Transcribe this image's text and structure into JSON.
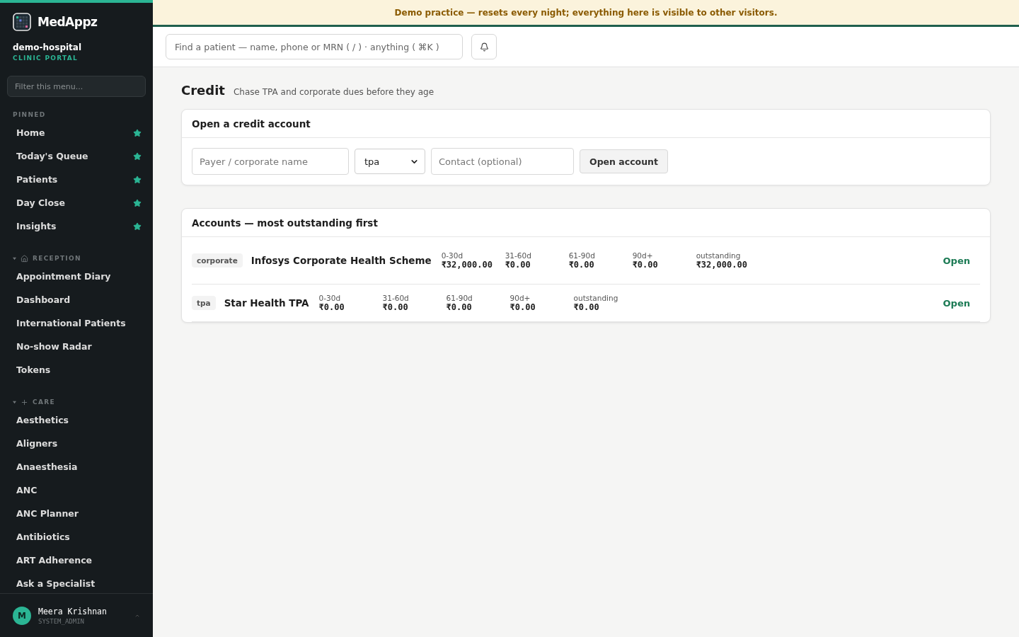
{
  "banner": "Demo practice — resets every night; everything here is visible to other visitors.",
  "brand": {
    "name": "MedAppz",
    "org": "demo-hospital",
    "portal": "CLINIC PORTAL"
  },
  "sidebar": {
    "filter_placeholder": "Filter this menu...",
    "pinned_title": "PINNED",
    "pinned": [
      {
        "label": "Home",
        "starred": true
      },
      {
        "label": "Today's Queue",
        "starred": true
      },
      {
        "label": "Patients",
        "starred": true
      },
      {
        "label": "Day Close",
        "starred": true
      },
      {
        "label": "Insights",
        "starred": true
      }
    ],
    "sections": [
      {
        "title": "RECEPTION",
        "kind": "home",
        "expanded": true,
        "items": [
          "Appointment Diary",
          "Dashboard",
          "International Patients",
          "No-show Radar",
          "Tokens"
        ]
      },
      {
        "title": "CARE",
        "kind": "plus",
        "expanded": true,
        "items": [
          "Aesthetics",
          "Aligners",
          "Anaesthesia",
          "ANC",
          "ANC Planner",
          "Antibiotics",
          "ART Adherence",
          "Ask a Specialist"
        ]
      }
    ],
    "user": {
      "initial": "M",
      "name": "Meera Krishnan",
      "role": "SYSTEM_ADMIN"
    }
  },
  "search": {
    "placeholder": "Find a patient — name, phone or MRN ( / ) · anything ( ⌘K )"
  },
  "page": {
    "title": "Credit",
    "subtitle": "Chase TPA and corporate dues before they age"
  },
  "open_account": {
    "title": "Open a credit account",
    "payer_placeholder": "Payer / corporate name",
    "type_value": "tpa",
    "contact_placeholder": "Contact (optional)",
    "button": "Open account"
  },
  "accounts": {
    "title": "Accounts — most outstanding first",
    "rows": [
      {
        "type": "corporate",
        "name": "Infosys Corporate Health Scheme",
        "buckets": [
          {
            "label": "0-30d",
            "value": "₹32,000.00"
          },
          {
            "label": "31-60d",
            "value": "₹0.00"
          },
          {
            "label": "61-90d",
            "value": "₹0.00"
          },
          {
            "label": "90d+",
            "value": "₹0.00"
          },
          {
            "label": "outstanding",
            "value": "₹32,000.00"
          }
        ],
        "action": "Open"
      },
      {
        "type": "tpa",
        "name": "Star Health TPA",
        "buckets": [
          {
            "label": "0-30d",
            "value": "₹0.00"
          },
          {
            "label": "31-60d",
            "value": "₹0.00"
          },
          {
            "label": "61-90d",
            "value": "₹0.00"
          },
          {
            "label": "90d+",
            "value": "₹0.00"
          },
          {
            "label": "outstanding",
            "value": "₹0.00"
          }
        ],
        "action": "Open"
      }
    ]
  }
}
